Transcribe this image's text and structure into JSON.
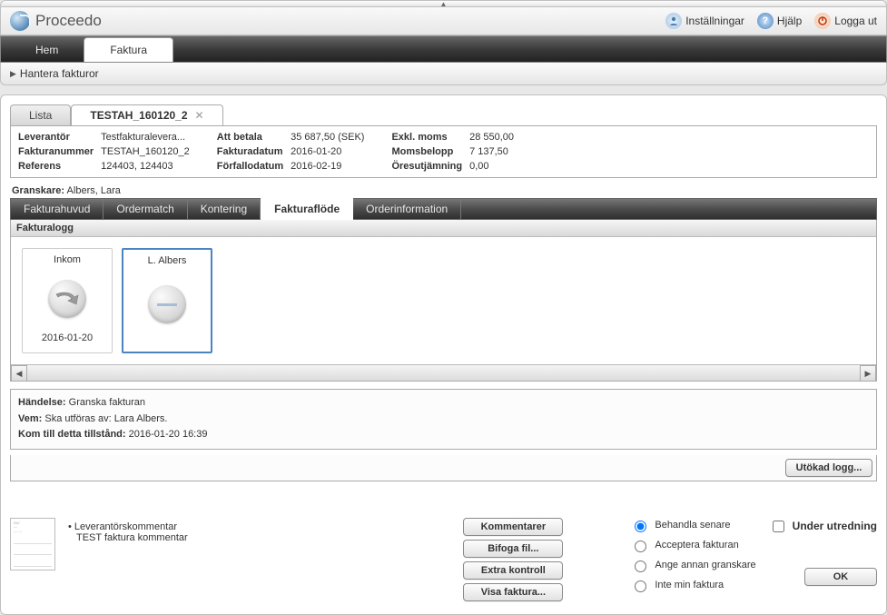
{
  "brand": "Proceedo",
  "header_links": {
    "settings": "Inställningar",
    "help": "Hjälp",
    "logout": "Logga ut"
  },
  "nav_tabs": {
    "home": "Hem",
    "invoice": "Faktura"
  },
  "subnav": "Hantera fakturor",
  "inner_tabs": {
    "list": "Lista",
    "doc": "TESTAH_160120_2"
  },
  "summary": {
    "supplier_lbl": "Leverantör",
    "supplier": "Testfakturalevera...",
    "invno_lbl": "Fakturanummer",
    "invno": "TESTAH_160120_2",
    "ref_lbl": "Referens",
    "ref": "124403, 124403",
    "pay_lbl": "Att betala",
    "pay": "35 687,50 (SEK)",
    "invdate_lbl": "Fakturadatum",
    "invdate": "2016-01-20",
    "due_lbl": "Förfallodatum",
    "due": "2016-02-19",
    "exvat_lbl": "Exkl. moms",
    "exvat": "28 550,00",
    "vat_lbl": "Momsbelopp",
    "vat": "7 137,50",
    "rounding_lbl": "Öresutjämning",
    "rounding": "0,00"
  },
  "reviewer_lbl": "Granskare:",
  "reviewer": "Albers, Lara",
  "section_tabs": {
    "head": "Fakturahuvud",
    "match": "Ordermatch",
    "kont": "Kontering",
    "flow": "Fakturaflöde",
    "orderinfo": "Orderinformation"
  },
  "flow": {
    "title": "Fakturalogg",
    "cards": [
      {
        "name": "Inkom",
        "date": "2016-01-20"
      },
      {
        "name": "L. Albers",
        "date": ""
      }
    ]
  },
  "event": {
    "handelse_lbl": "Händelse:",
    "handelse": "Granska fakturan",
    "vem_lbl": "Vem:",
    "vem": "Ska utföras av: Lara Albers.",
    "kom_lbl": "Kom till detta tillstånd:",
    "kom": "2016-01-20 16:39"
  },
  "buttons": {
    "extlog": "Utökad logg...",
    "comments": "Kommentarer",
    "attach": "Bifoga fil...",
    "extra": "Extra kontroll",
    "show": "Visa faktura...",
    "ok": "OK"
  },
  "vendor_comment_lbl": "Leverantörskommentar",
  "vendor_comment": "TEST faktura kommentar",
  "radios": {
    "later": "Behandla senare",
    "accept": "Acceptera fakturan",
    "other": "Ange annan granskare",
    "notmine": "Inte min faktura"
  },
  "under_invest": "Under utredning"
}
